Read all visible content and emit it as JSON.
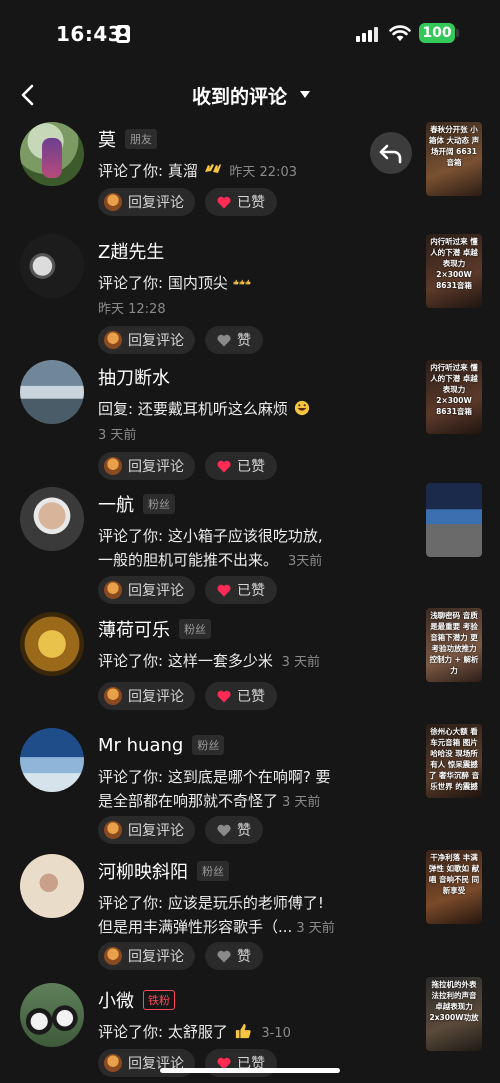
{
  "status_bar": {
    "time": "16:43",
    "battery": "100"
  },
  "nav": {
    "title": "收到的评论"
  },
  "actions": {
    "reply_label": "回复评论",
    "liked_label": "已赞",
    "like_label": "赞"
  },
  "comments": [
    {
      "name": "莫",
      "tag": "朋友",
      "text": "评论了你: 真溜",
      "emoji": "clap-emoji",
      "time": "昨天 22:03",
      "liked": true,
      "thumb_text": "春秋分开张 小箱体 大动态 声场开阔 6631音箱"
    },
    {
      "name": "Z趙先生",
      "tag": "",
      "text": "评论了你: 国内顶尖",
      "emoji": "thumbs-up-emoji",
      "time": "昨天 12:28",
      "liked": false,
      "thumb_text": "内行听过来 懂人的下潜 卓越表现力 2×300W 8631音箱"
    },
    {
      "name": "抽刀断水",
      "tag": "",
      "text": "回复: 还要戴耳机听这么麻烦",
      "emoji": "laugh-emoji",
      "time": "3 天前",
      "liked": true,
      "thumb_text": "内行听过来 懂人的下潜 卓越表现力 2×300W 8631音箱"
    },
    {
      "name": "一航",
      "tag": "粉丝",
      "text_line1": "评论了你: 这小箱子应该很吃功放,",
      "text_line2": "一般的胆机可能推不出来。",
      "time": "3天前",
      "liked": true,
      "thumb_text": ""
    },
    {
      "name": "薄荷可乐",
      "tag": "粉丝",
      "text": "评论了你: 这样一套多少米",
      "time": "3 天前",
      "liked": true,
      "thumb_text": "浅聊密码 音质是最重要 考验音箱下潜力 更考验功放推力 控制力 + 解析力"
    },
    {
      "name": "Mr huang",
      "tag": "粉丝",
      "text_line1": "评论了你: 这到底是哪个在响啊? 要",
      "text_line2": "是全部都在响那就不奇怪了",
      "time": "3 天前",
      "liked": false,
      "thumb_text": "徐州心大额 看车元音箱 图片 哈哈没 现场所有人 惊呆震撼了 奢华沉醉 音乐世界 的震撼"
    },
    {
      "name": "河柳映斜阳",
      "tag": "粉丝",
      "text_line1": "评论了你: 应该是玩乐的老师傅了!",
      "text_line2": "但是用丰满弹性形容歌手（...",
      "time": "3 天前",
      "liked": false,
      "thumb_text": "干净利落 丰满弹性 如歌如 献 唱 音响不民 同新享受"
    },
    {
      "name": "小微",
      "tag": "铁粉",
      "text": "评论了你: 太舒服了",
      "emoji": "thumbs-up-emoji",
      "time": "3-10",
      "liked": true,
      "thumb_text": "拖拉机的外表 法拉利的声音 卓越表现力 2x300W功放"
    }
  ]
}
